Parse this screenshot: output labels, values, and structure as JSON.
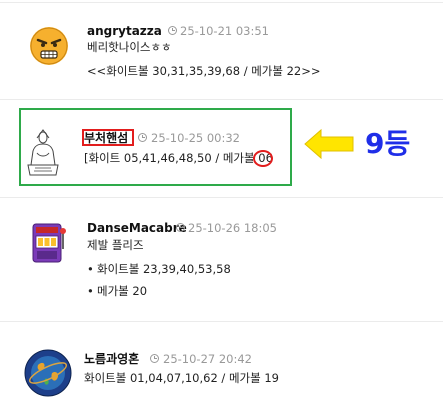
{
  "posts": [
    {
      "user": "angrytazza",
      "date": "25-10-21 03:51",
      "lines": [
        "베리핫나이스ㅎㅎ",
        "<<화이트볼 30,31,35,39,68 / 메가볼 22>>"
      ]
    },
    {
      "user": "부처핸섬",
      "date": "25-10-25 00:32",
      "lines": [
        "[화이트 05,41,46,48,50 / 메가볼 06"
      ]
    },
    {
      "user": "DanseMacabre",
      "date": "25-10-26 18:05",
      "lines": [
        "제발 플리즈",
        "화이트볼 23,39,40,53,58",
        "메가볼 20"
      ]
    },
    {
      "user": "노름과영혼",
      "date": "25-10-27 20:42",
      "lines": [
        "화이트볼 01,04,07,10,62 / 메가볼 19"
      ]
    }
  ],
  "annotation": {
    "rank_label": "9등"
  },
  "colors": {
    "highlight_box": "#2eaa4a",
    "mark_red": "#e21d1d",
    "rank_blue": "#1f2ee8",
    "arrow_yellow": "#ffe500",
    "date_gray": "#999999"
  }
}
